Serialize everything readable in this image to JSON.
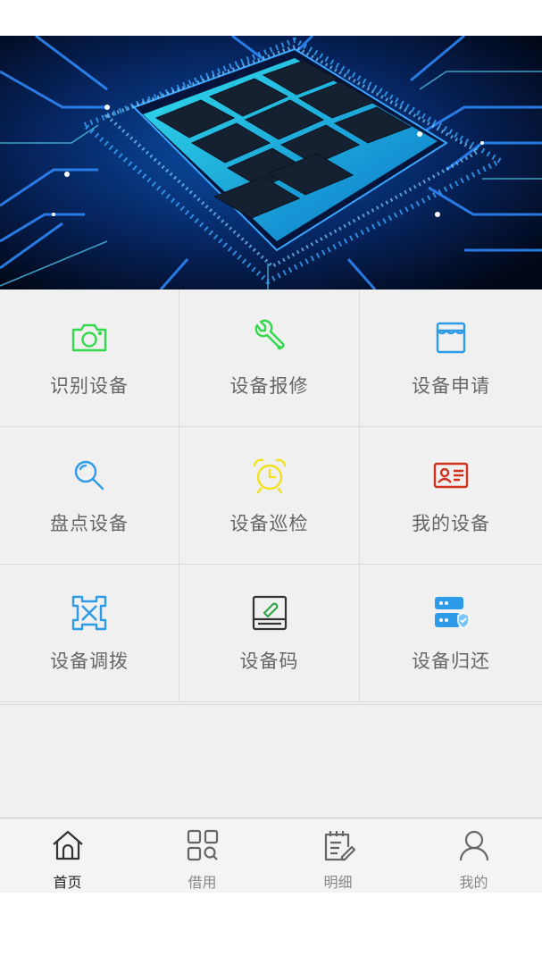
{
  "banner": {
    "image_name": "circuit-chip-banner",
    "carousel": {
      "total": 2,
      "active": 0
    }
  },
  "grid": {
    "items": [
      {
        "label": "识别设备",
        "icon": "camera-icon",
        "color": "#32d94a"
      },
      {
        "label": "设备报修",
        "icon": "wrench-icon",
        "color": "#32d94a"
      },
      {
        "label": "设备申请",
        "icon": "store-icon",
        "color": "#2e9be8"
      },
      {
        "label": "盘点设备",
        "icon": "magnifier-icon",
        "color": "#2e9be8"
      },
      {
        "label": "设备巡检",
        "icon": "alarm-clock-icon",
        "color": "#f2e11d"
      },
      {
        "label": "我的设备",
        "icon": "id-card-icon",
        "color": "#d0321e"
      },
      {
        "label": "设备调拨",
        "icon": "transfer-icon",
        "color": "#2e9be8"
      },
      {
        "label": "设备码",
        "icon": "device-repair-icon",
        "color": "#333333"
      },
      {
        "label": "设备归还",
        "icon": "server-check-icon",
        "color": "#2e9be8"
      }
    ]
  },
  "tabbar": {
    "active_index": 0,
    "tabs": [
      {
        "label": "首页",
        "icon": "home-icon"
      },
      {
        "label": "借用",
        "icon": "apps-search-icon"
      },
      {
        "label": "明细",
        "icon": "notepad-icon"
      },
      {
        "label": "我的",
        "icon": "user-icon"
      }
    ]
  }
}
